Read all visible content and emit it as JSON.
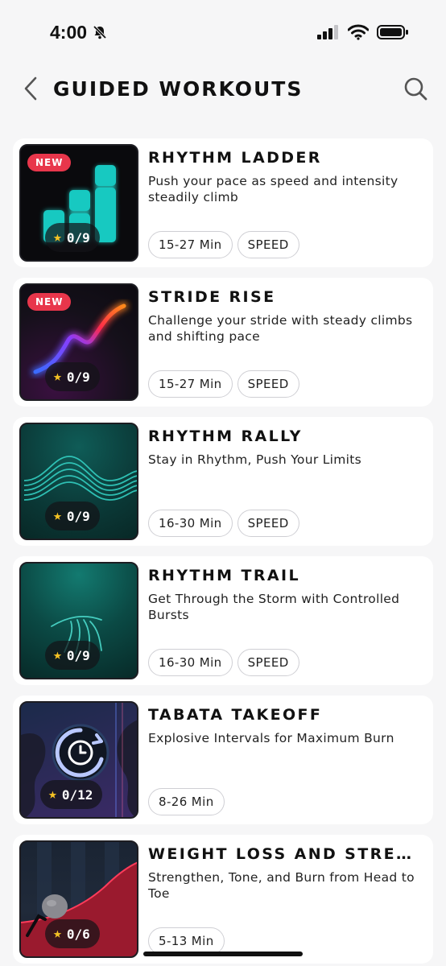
{
  "status": {
    "time": "4:00"
  },
  "header": {
    "title": "GUIDED WORKOUTS"
  },
  "workouts": [
    {
      "title": "RHYTHM LADDER",
      "badge": "NEW",
      "description": "Push your pace as speed and intensity steadily climb",
      "progress": "0/9",
      "tags": [
        "15-27 Min",
        "SPEED"
      ]
    },
    {
      "title": "STRIDE RISE",
      "badge": "NEW",
      "description": "Challenge your stride with steady climbs and shifting pace",
      "progress": "0/9",
      "tags": [
        "15-27 Min",
        "SPEED"
      ]
    },
    {
      "title": "RHYTHM RALLY",
      "description": "Stay in Rhythm, Push Your Limits",
      "progress": "0/9",
      "tags": [
        "16-30 Min",
        "SPEED"
      ]
    },
    {
      "title": "RHYTHM TRAIL",
      "description": "Get Through the Storm with Controlled Bursts",
      "progress": "0/9",
      "tags": [
        "16-30 Min",
        "SPEED"
      ]
    },
    {
      "title": "TABATA TAKEOFF",
      "description": "Explosive Intervals for Maximum Burn",
      "progress": "0/12",
      "tags": [
        "8-26 Min"
      ]
    },
    {
      "title": "WEIGHT LOSS AND STRENGTH",
      "description": "Strengthen, Tone, and Burn from Head to Toe",
      "progress": "0/6",
      "tags": [
        "5-13 Min"
      ]
    }
  ]
}
